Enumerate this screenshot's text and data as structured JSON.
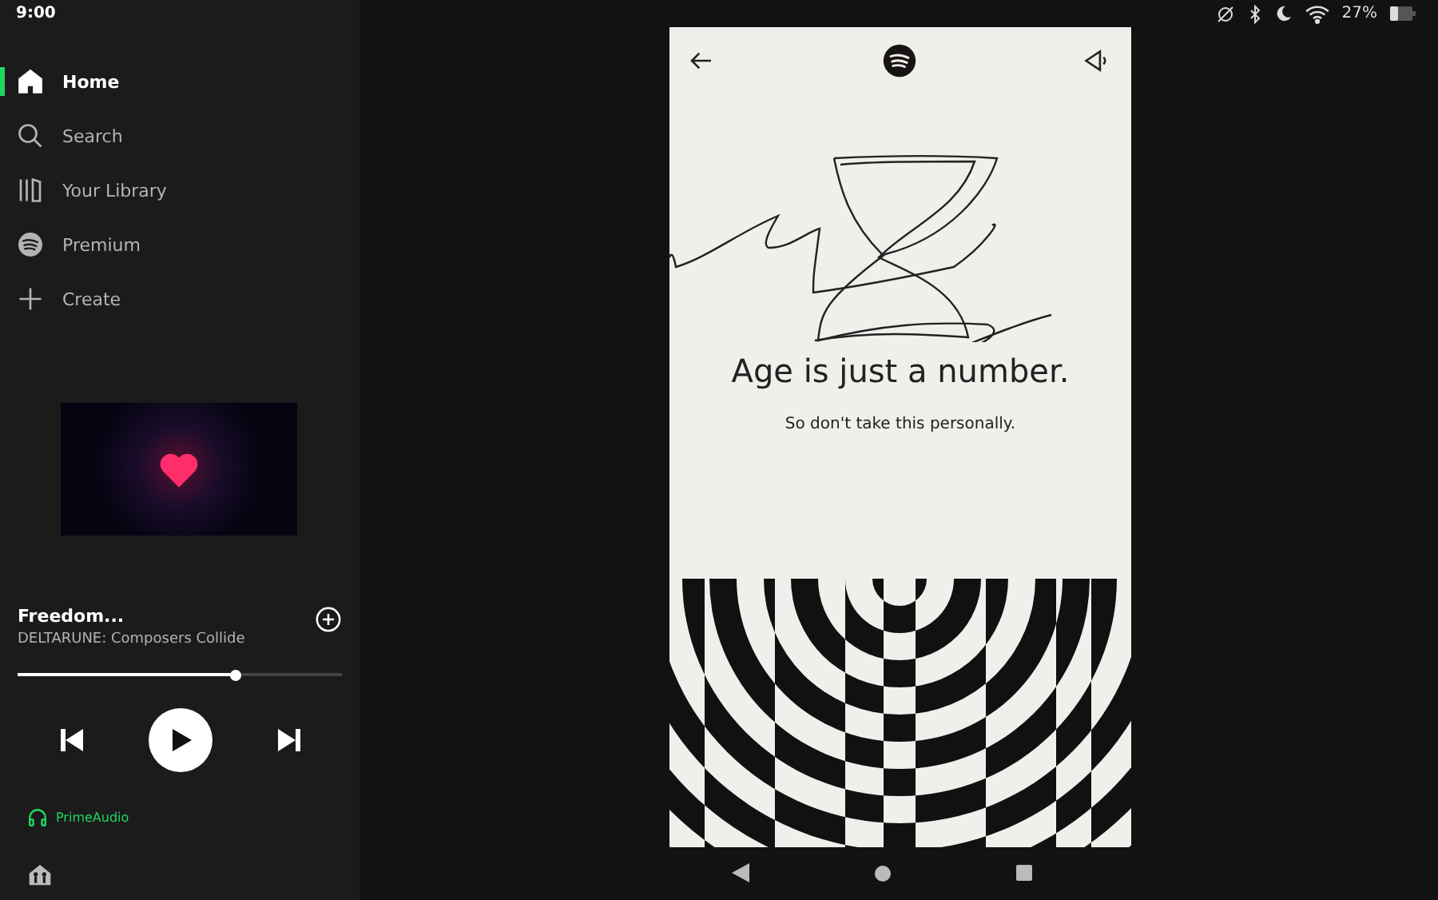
{
  "status_bar": {
    "time": "9:00",
    "battery": "27%"
  },
  "sidebar": {
    "items": [
      {
        "kind": "home",
        "label": "Home",
        "selected": true
      },
      {
        "kind": "search",
        "label": "Search",
        "selected": false
      },
      {
        "kind": "library",
        "label": "Your Library",
        "selected": false
      },
      {
        "kind": "premium",
        "label": "Premium",
        "selected": false
      },
      {
        "kind": "create",
        "label": "Create",
        "selected": false
      }
    ]
  },
  "now_playing": {
    "title": "Freedom...",
    "artist": "DELTARUNE: Composers Collide",
    "progress": {
      "level": 0.67
    },
    "device": "PrimeAudio"
  },
  "story": {
    "heading": "Age is just a number.",
    "subtext": "So don't take this personally."
  }
}
